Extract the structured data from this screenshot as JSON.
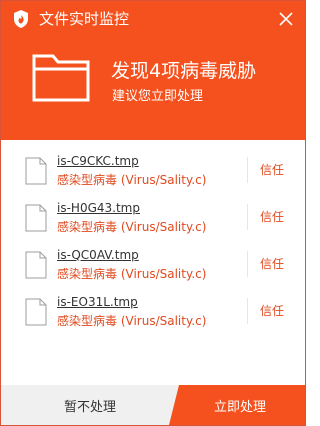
{
  "window": {
    "title": "文件实时监控"
  },
  "alert": {
    "headline": "发现4项病毒威胁",
    "subline": "建议您立即处理"
  },
  "items": [
    {
      "filename": "is-C9CKC.tmp",
      "virus": "感染型病毒 (Virus/Sality.c)",
      "action": "信任"
    },
    {
      "filename": "is-H0G43.tmp",
      "virus": "感染型病毒 (Virus/Sality.c)",
      "action": "信任"
    },
    {
      "filename": "is-QC0AV.tmp",
      "virus": "感染型病毒 (Virus/Sality.c)",
      "action": "信任"
    },
    {
      "filename": "is-EO31L.tmp",
      "virus": "感染型病毒 (Virus/Sality.c)",
      "action": "信任"
    }
  ],
  "footer": {
    "later_label": "暂不处理",
    "now_label": "立即处理"
  },
  "colors": {
    "accent": "#f4511e",
    "danger_text": "#e04a1f"
  }
}
